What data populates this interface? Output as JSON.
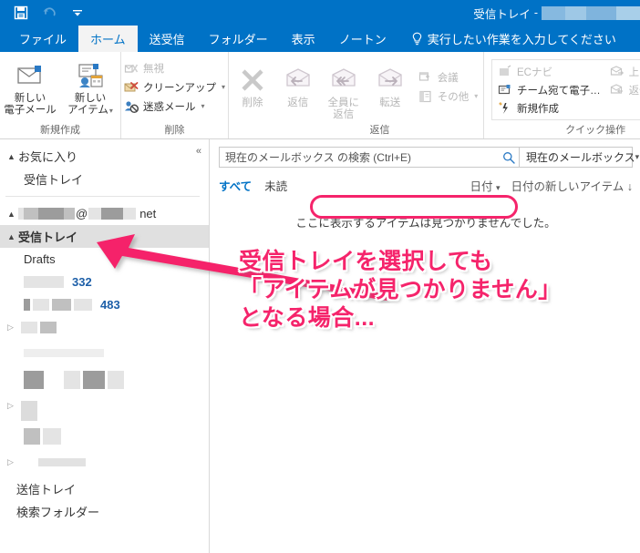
{
  "window": {
    "title_prefix": "受信トレイ",
    "title_separator": "-",
    "accent_color": "#0072C6",
    "annotation_color": "#F5246B"
  },
  "quick_access_toolbar": {
    "items": [
      {
        "name": "save-icon",
        "label": "上書き保存"
      },
      {
        "name": "undo-icon",
        "label": "元に戻す"
      },
      {
        "name": "qat-dropdown-icon",
        "label": "クイック アクセス ツール バーのユーザー設定"
      }
    ]
  },
  "ribbon": {
    "tabs": [
      {
        "label": "ファイル",
        "active": false
      },
      {
        "label": "ホーム",
        "active": true
      },
      {
        "label": "送受信",
        "active": false
      },
      {
        "label": "フォルダー",
        "active": false
      },
      {
        "label": "表示",
        "active": false
      },
      {
        "label": "ノートン",
        "active": false
      }
    ],
    "tell_me": "実行したい作業を入力してください",
    "groups": [
      {
        "label": "新規作成",
        "big_buttons": [
          {
            "line1": "新しい",
            "line2": "電子メール",
            "icon": "new-mail-icon",
            "disabled": false,
            "has_caret": false
          },
          {
            "line1": "新しい",
            "line2": "アイテム",
            "icon": "new-items-icon",
            "disabled": false,
            "has_caret": true
          }
        ]
      },
      {
        "label": "削除",
        "small_buttons": [
          {
            "label": "無視",
            "icon": "ignore-icon",
            "disabled": true,
            "has_caret": false
          },
          {
            "label": "クリーンアップ",
            "icon": "cleanup-icon",
            "disabled": false,
            "has_caret": true
          },
          {
            "label": "迷惑メール",
            "icon": "junk-icon",
            "disabled": false,
            "has_caret": true
          }
        ],
        "big_buttons": [
          {
            "line1": "削除",
            "line2": "",
            "icon": "delete-x-icon",
            "disabled": true,
            "has_caret": false
          }
        ]
      },
      {
        "label": "返信",
        "big_buttons": [
          {
            "line1": "返信",
            "line2": "",
            "icon": "reply-icon",
            "disabled": true,
            "has_caret": false
          },
          {
            "line1": "全員に",
            "line2": "返信",
            "icon": "reply-all-icon",
            "disabled": true,
            "has_caret": false
          },
          {
            "line1": "転送",
            "line2": "",
            "icon": "forward-icon",
            "disabled": true,
            "has_caret": false
          }
        ],
        "small_buttons": [
          {
            "label": "会議",
            "icon": "meeting-icon",
            "disabled": true,
            "has_caret": false
          },
          {
            "label": "その他",
            "icon": "more-icon",
            "disabled": true,
            "has_caret": true
          }
        ]
      },
      {
        "label": "クイック操作",
        "quick_steps_col1": [
          {
            "label": "ECナビ",
            "icon": "quickstep-move-icon",
            "disabled": true
          },
          {
            "label": "チーム宛て電子…",
            "icon": "quickstep-team-icon",
            "disabled": false
          },
          {
            "label": "新規作成",
            "icon": "quickstep-new-icon",
            "disabled": false
          }
        ],
        "quick_steps_col2": [
          {
            "label": "上司に転送",
            "icon": "quickstep-forward-boss-icon",
            "disabled": true
          },
          {
            "label": "返信して削除",
            "icon": "quickstep-reply-delete-icon",
            "disabled": true
          }
        ]
      }
    ]
  },
  "sidebar": {
    "collapse_icon": "«",
    "favorites": {
      "label": "お気に入り",
      "expanded": true,
      "items": [
        {
          "label": "受信トレイ"
        }
      ]
    },
    "account": {
      "label_suffix": "net",
      "at_sign": "@",
      "expanded": true
    },
    "folders": [
      {
        "label": "受信トレイ",
        "selected": true,
        "expanded": true,
        "indent": 0,
        "has_triangle": true,
        "redacted": false
      },
      {
        "label": "Drafts",
        "selected": false,
        "indent": 1,
        "has_triangle": false,
        "redacted": false
      },
      {
        "label": "",
        "count": "332",
        "selected": false,
        "indent": 1,
        "has_triangle": false,
        "redacted": true
      },
      {
        "label": "",
        "count": "483",
        "selected": false,
        "indent": 1,
        "has_triangle": false,
        "redacted": true
      },
      {
        "label": "",
        "selected": false,
        "indent": 0,
        "has_triangle": true,
        "triangle_state": "closed",
        "redacted": true
      },
      {
        "label": "",
        "selected": false,
        "indent": 1,
        "has_triangle": false,
        "redacted": true
      },
      {
        "label": "",
        "selected": false,
        "indent": 0,
        "has_triangle": true,
        "triangle_state": "closed",
        "redacted": true
      },
      {
        "label": "",
        "selected": false,
        "indent": 1,
        "has_triangle": false,
        "redacted": true
      },
      {
        "label": "",
        "selected": false,
        "indent": 0,
        "has_triangle": true,
        "triangle_state": "closed",
        "redacted": true
      },
      {
        "label": "送信トレイ",
        "selected": false,
        "indent": 0,
        "has_triangle": false,
        "redacted": false
      },
      {
        "label": "検索フォルダー",
        "selected": false,
        "indent": 0,
        "has_triangle": false,
        "redacted": false
      }
    ]
  },
  "message_list": {
    "search": {
      "placeholder": "現在のメールボックス の検索 (Ctrl+E)",
      "icon": "search-icon",
      "scope_value": "現在のメールボックス",
      "scope_caret": "▾"
    },
    "filters": {
      "all": "すべて",
      "unread": "未読",
      "sort_field": "日付",
      "sort_field_caret": "▾",
      "sort_order": "日付の新しいアイテム",
      "sort_order_arrow": "↓"
    },
    "empty_message": "ここに表示するアイテムは見つかりませんでした。"
  },
  "annotations": {
    "highlight_target": "empty-message-highlight",
    "callout_lines": [
      "受信トレイを選択しても",
      "「アイテムが見つかりません」",
      "となる場合..."
    ],
    "arrow": "arrow-pointing-to-inbox-folder"
  }
}
